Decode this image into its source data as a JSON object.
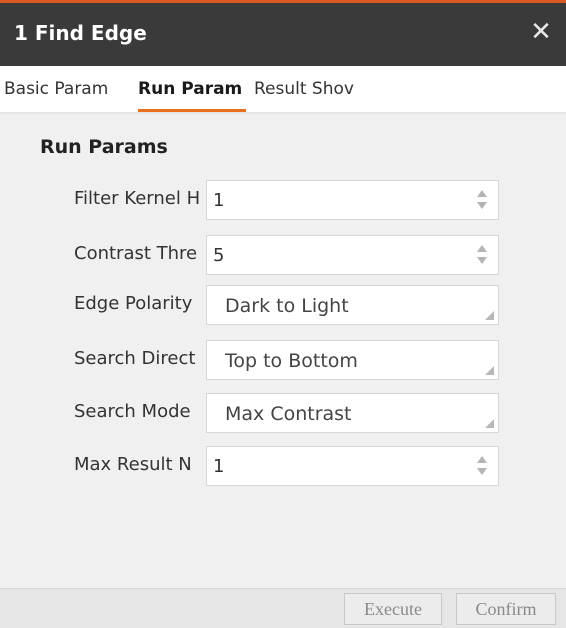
{
  "window": {
    "title": "1 Find Edge",
    "close_glyph": "✕"
  },
  "tabs": [
    {
      "label": "Basic Param",
      "active": false
    },
    {
      "label": "Run Param",
      "active": true
    },
    {
      "label": "Result Shov",
      "active": false
    }
  ],
  "section": {
    "title": "Run Params"
  },
  "params": [
    {
      "label": "Filter Kernel H",
      "value": "1",
      "control": "spinbox"
    },
    {
      "label": "Contrast Thre",
      "value": "5",
      "control": "spinbox"
    },
    {
      "label": "Edge Polarity",
      "value": "Dark to Light",
      "control": "select"
    },
    {
      "label": "Search Direct",
      "value": "Top to Bottom",
      "control": "select"
    },
    {
      "label": "Search Mode",
      "value": "Max Contrast",
      "control": "select"
    },
    {
      "label": "Max Result N",
      "value": "1",
      "control": "spinbox"
    }
  ],
  "footer": {
    "execute_label": "Execute",
    "confirm_label": "Confirm"
  },
  "colors": {
    "titlebar_bg": "#3a3a3a",
    "titlebar_accent": "#d85a20",
    "active_tab_underline": "#e8711f",
    "panel_bg": "#f0f0f0",
    "footer_bg": "#e6e6e6"
  }
}
